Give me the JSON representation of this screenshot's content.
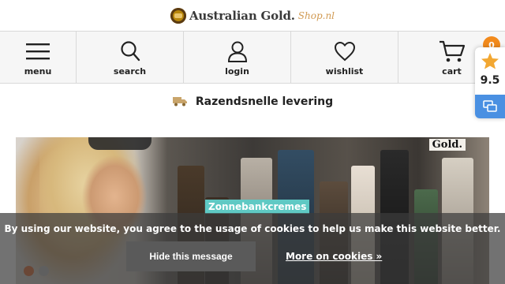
{
  "header": {
    "logo_text": "Australian Gold.",
    "logo_sub": "Shop.nl"
  },
  "nav": {
    "items": [
      {
        "label": "menu",
        "icon": "hamburger-icon"
      },
      {
        "label": "search",
        "icon": "search-icon"
      },
      {
        "label": "login",
        "icon": "user-icon"
      },
      {
        "label": "wishlist",
        "icon": "heart-icon"
      },
      {
        "label": "cart",
        "icon": "cart-icon"
      }
    ],
    "cart_count": "0"
  },
  "rating": {
    "score": "9.5",
    "icon": "star-icon"
  },
  "delivery": {
    "text": "Razendsnelle levering",
    "icon": "truck-icon"
  },
  "hero": {
    "brand_text": "Gold.",
    "category_label": "Zonnebankcremes",
    "slides": 2,
    "active_slide": 1
  },
  "cookie": {
    "text": "By using our website, you agree to the usage of cookies to help us make this website better.",
    "hide_label": "Hide this message",
    "more_label": "More on cookies »"
  },
  "colors": {
    "accent": "#f28a1c",
    "category": "#5fc9c4",
    "rating_button": "#4a90e2"
  }
}
